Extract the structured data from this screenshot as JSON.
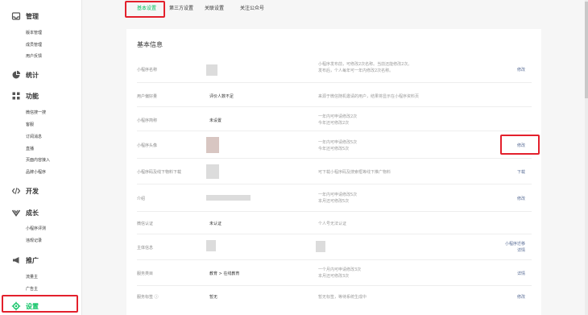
{
  "sidebar": {
    "groups": [
      {
        "label": "管理",
        "icon": "inbox-icon",
        "items": [
          "版本管理",
          "成员管理",
          "用户反馈"
        ]
      },
      {
        "label": "统计",
        "icon": "pie-chart-icon",
        "items": []
      },
      {
        "label": "功能",
        "icon": "grid-icon",
        "items": [
          "微信搜一搜",
          "客服",
          "订阅消息",
          "直播",
          "页面内容接入",
          "品牌小程序"
        ]
      },
      {
        "label": "开发",
        "icon": "code-icon",
        "items": []
      },
      {
        "label": "成长",
        "icon": "growth-icon",
        "items": [
          "小程序评测",
          "违规记录"
        ]
      },
      {
        "label": "推广",
        "icon": "megaphone-icon",
        "items": [
          "流量主",
          "广告主"
        ]
      },
      {
        "label": "设置",
        "icon": "gear-icon",
        "items": []
      }
    ]
  },
  "tabs": [
    "基本设置",
    "第三方设置",
    "关联设置",
    "关注公众号"
  ],
  "panel": {
    "title": "基本信息",
    "rows": [
      {
        "label": "小程序名称",
        "value": "",
        "desc": [
          "小程序发布前，可修改2次名称。当前还能修改2次。",
          "发布后，个人每年可一年内修改2次名称。"
        ],
        "action": [
          "修改"
        ]
      },
      {
        "label": "用户偏好量",
        "value": "评价人数不足",
        "desc": [
          "来源于微信随机邀请的用户，结果将显示在小程序资料页"
        ],
        "action": []
      },
      {
        "label": "小程序简称",
        "value": "未设置",
        "desc": [
          "一年内可申请修改2次",
          "今年还可修改2次"
        ],
        "action": []
      },
      {
        "label": "小程序头像",
        "value": "",
        "desc": [
          "一年内可申请修改5次",
          "今年还可修改5次"
        ],
        "action": [
          "修改"
        ]
      },
      {
        "label": "小程序码及线下物料下载",
        "value": "",
        "desc": [
          "可下载小程序码及搜索框等线下推广物料"
        ],
        "action": [
          "下载"
        ]
      },
      {
        "label": "介绍",
        "value": "",
        "desc": [
          "一年内可申请修改5次",
          "本月还可修改5次"
        ],
        "action": [
          "修改"
        ]
      },
      {
        "label": "微信认证",
        "value": "未认证",
        "desc": [
          "个人号无法认证"
        ],
        "action": []
      },
      {
        "label": "主体信息",
        "value": "",
        "desc": [],
        "action": [
          "小程序迁移",
          "详情"
        ]
      },
      {
        "label": "服务类目",
        "value": "教育 > 在线教育",
        "desc": [
          "一个月内可申请修改3次",
          "本月还可修改3次"
        ],
        "action": [
          "详情"
        ]
      },
      {
        "label": "服务标签 ⓘ",
        "value": "暂无",
        "desc": [
          "暂无标签，等待系统生成中"
        ],
        "action": [
          "修改"
        ]
      }
    ]
  },
  "colors": {
    "accent": "#07c160",
    "link": "#576b95",
    "highlight": "#e3202c"
  }
}
